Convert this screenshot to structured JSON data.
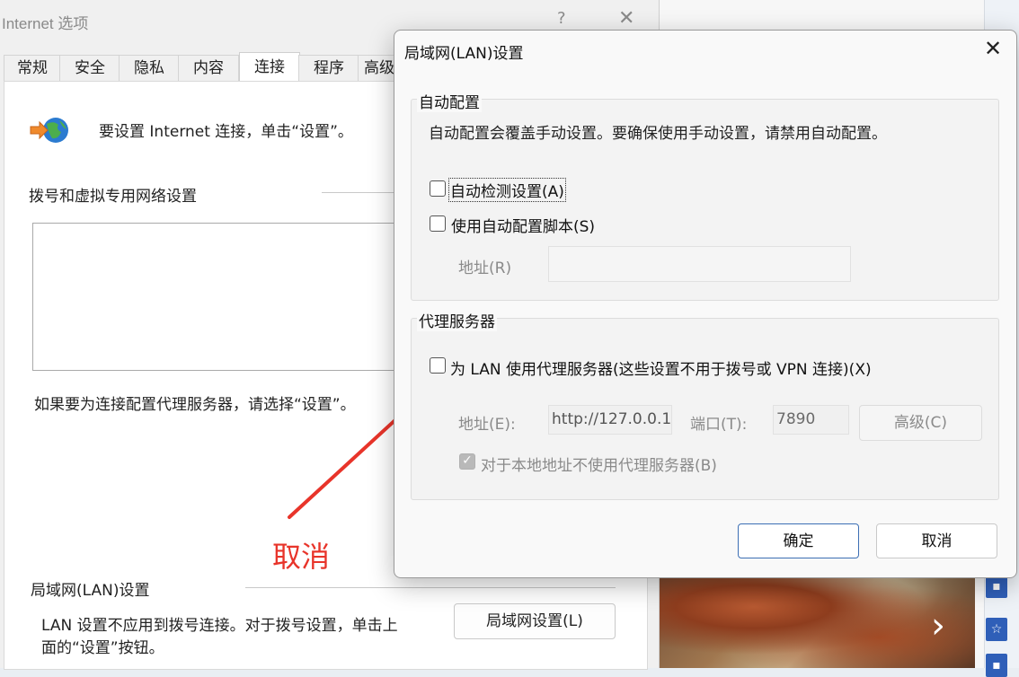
{
  "background_window": {
    "title": "Internet 选项",
    "help_glyph": "?",
    "close_glyph": "✕",
    "tabs": [
      {
        "label": "常规"
      },
      {
        "label": "安全"
      },
      {
        "label": "隐私"
      },
      {
        "label": "内容"
      },
      {
        "label": "连接",
        "active": true
      },
      {
        "label": "程序"
      },
      {
        "label": "高级"
      }
    ],
    "intro_text": "要设置 Internet 连接，单击“设置”。",
    "dialup_heading": "拨号和虚拟专用网络设置",
    "proxy_note": "如果要为连接配置代理服务器，请选择“设置”。",
    "lan_heading": "局域网(LAN)设置",
    "lan_desc_line1": "LAN 设置不应用到拨号连接。对于拨号设置，单击上",
    "lan_desc_line2": "面的“设置”按钮。",
    "lan_button": "局域网设置(L)",
    "icon": "globe-arrow-icon"
  },
  "annotation": {
    "label": "取消",
    "color": "#e8342a"
  },
  "background_photo": {
    "next_glyph": "›"
  },
  "dialog": {
    "title": "局域网(LAN)设置",
    "close_glyph": "✕",
    "auto_config": {
      "group_title": "自动配置",
      "description": "自动配置会覆盖手动设置。要确保使用手动设置，请禁用自动配置。",
      "auto_detect": {
        "label": "自动检测设置(A)",
        "checked": false
      },
      "use_script": {
        "label": "使用自动配置脚本(S)",
        "checked": false
      },
      "address_label": "地址(R)",
      "address_value": ""
    },
    "proxy": {
      "group_title": "代理服务器",
      "use_proxy": {
        "label": "为 LAN 使用代理服务器(这些设置不用于拨号或 VPN 连接)(X)",
        "checked": false
      },
      "address_label": "地址(E):",
      "address_value": "http://127.0.0.1",
      "port_label": "端口(T):",
      "port_value": "7890",
      "advanced_button": "高级(C)",
      "bypass_local": {
        "label": "对于本地地址不使用代理服务器(B)",
        "checked": true
      }
    },
    "ok_button": "确定",
    "cancel_button": "取消"
  },
  "colors": {
    "annotation_red": "#e8342a",
    "ok_border": "#3c6fb4"
  }
}
